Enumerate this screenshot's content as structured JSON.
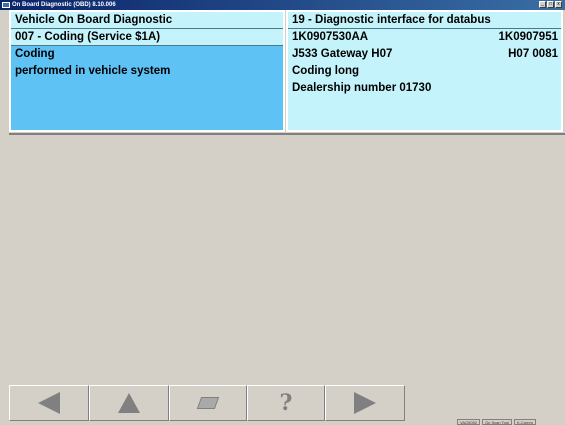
{
  "window": {
    "title": "On Board Diagnostic (OBD) 8.10.006",
    "min_label": "_",
    "max_label": "□",
    "close_label": "x"
  },
  "left_panel": {
    "row1": "Vehicle On Board Diagnostic",
    "row2": "007 - Coding (Service $1A)",
    "row3": "Coding",
    "row4": "performed in vehicle system"
  },
  "right_panel": {
    "row1": "19 - Diagnostic interface for databus",
    "row2_left": "1K0907530AA",
    "row2_right": "1K0907951",
    "row3_left": "J533  Gateway  H07",
    "row3_right": "H07  0081",
    "row4": "Coding long",
    "row5": "Dealership number 01730"
  },
  "toolbar": {
    "help_label": "?"
  },
  "statusbar": {
    "cell1": "VAG5052",
    "cell2": "On Scan Tool",
    "cell3": "K-Comm"
  },
  "colors": {
    "panel_bg": "#c4f3fb",
    "highlight_bg": "#5ec2f5",
    "titlebar": "#0a246a"
  }
}
